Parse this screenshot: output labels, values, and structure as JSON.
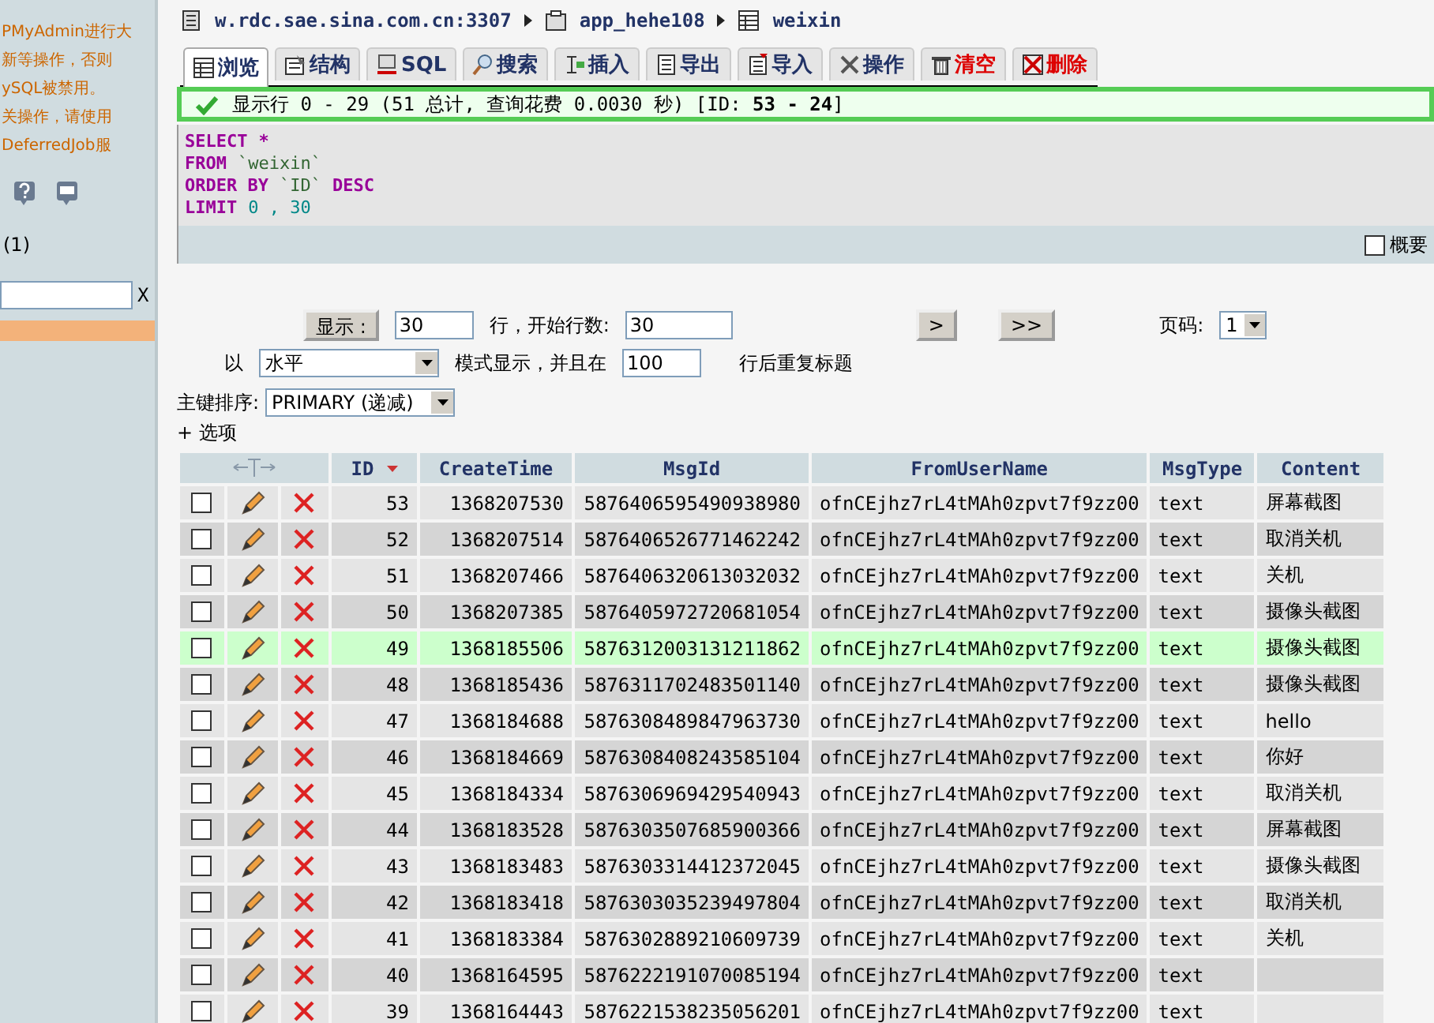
{
  "sidebar": {
    "notice_lines": [
      "PMyAdmin进行大",
      "新等操作，否则",
      "ySQL被禁用。",
      "关操作，请使用",
      "DeferredJob服"
    ],
    "count": "(1)",
    "filter_clear": "X"
  },
  "breadcrumb": {
    "server": "w.rdc.sae.sina.com.cn:3307",
    "database": "app_hehe108",
    "table": "weixin"
  },
  "tabs": [
    {
      "label": "浏览",
      "selected": true,
      "kind": "normal"
    },
    {
      "label": "结构",
      "selected": false,
      "kind": "normal"
    },
    {
      "label": "SQL",
      "selected": false,
      "kind": "normal"
    },
    {
      "label": "搜索",
      "selected": false,
      "kind": "normal"
    },
    {
      "label": "插入",
      "selected": false,
      "kind": "normal"
    },
    {
      "label": "导出",
      "selected": false,
      "kind": "normal"
    },
    {
      "label": "导入",
      "selected": false,
      "kind": "normal"
    },
    {
      "label": "操作",
      "selected": false,
      "kind": "normal"
    },
    {
      "label": "清空",
      "selected": false,
      "kind": "danger"
    },
    {
      "label": "删除",
      "selected": false,
      "kind": "danger"
    }
  ],
  "message": {
    "text": "显示行 0 - 29 (51 总计, 查询花费 0.0030 秒) [ID: **53 - 24**]"
  },
  "query": {
    "lines": [
      [
        {
          "kind": "keyword",
          "text": "SELECT"
        },
        {
          "kind": "keyword",
          "text": "*"
        }
      ],
      [
        {
          "kind": "keyword",
          "text": "FROM"
        },
        {
          "kind": "ident",
          "text": "`weixin`"
        }
      ],
      [
        {
          "kind": "keyword",
          "text": "ORDER BY"
        },
        {
          "kind": "ident",
          "text": "`ID`"
        },
        {
          "kind": "keyword",
          "text": "DESC"
        }
      ],
      [
        {
          "kind": "keyword",
          "text": "LIMIT"
        },
        {
          "kind": "number",
          "text": "0 , 30"
        }
      ]
    ],
    "profiling": {
      "label": "概要",
      "checked": false
    }
  },
  "navigation": {
    "show_button": "显示 :",
    "rows_value": "30",
    "rows_label": "行，开始行数:",
    "start_value": "30",
    "next_button": ">",
    "last_button": ">>",
    "page_label": "页码:",
    "page_value": "1",
    "mode_prefix": "以",
    "mode_value": "水平",
    "mode_label": "模式显示，并且在",
    "repeat_value": "100",
    "repeat_label": "行后重复标题",
    "sort_label": "主键排序:",
    "sort_value": "PRIMARY (递减)",
    "options_link": "+ 选项"
  },
  "table": {
    "columns": [
      "ID",
      "CreateTime",
      "MsgId",
      "FromUserName",
      "MsgType",
      "Content"
    ],
    "rows": [
      {
        "checked": false,
        "highlighted": false,
        "cells": [
          "53",
          "1368207530",
          "5876406595490938980",
          "ofnCEjhz7rL4tMAh0zpvt7f9zz00",
          "text",
          "屏幕截图"
        ]
      },
      {
        "checked": false,
        "highlighted": false,
        "cells": [
          "52",
          "1368207514",
          "5876406526771462242",
          "ofnCEjhz7rL4tMAh0zpvt7f9zz00",
          "text",
          "取消关机"
        ]
      },
      {
        "checked": false,
        "highlighted": false,
        "cells": [
          "51",
          "1368207466",
          "5876406320613032032",
          "ofnCEjhz7rL4tMAh0zpvt7f9zz00",
          "text",
          "关机"
        ]
      },
      {
        "checked": false,
        "highlighted": false,
        "cells": [
          "50",
          "1368207385",
          "5876405972720681054",
          "ofnCEjhz7rL4tMAh0zpvt7f9zz00",
          "text",
          "摄像头截图"
        ]
      },
      {
        "checked": false,
        "highlighted": true,
        "cells": [
          "49",
          "1368185506",
          "5876312003131211862",
          "ofnCEjhz7rL4tMAh0zpvt7f9zz00",
          "text",
          "摄像头截图"
        ]
      },
      {
        "checked": false,
        "highlighted": false,
        "cells": [
          "48",
          "1368185436",
          "5876311702483501140",
          "ofnCEjhz7rL4tMAh0zpvt7f9zz00",
          "text",
          "摄像头截图"
        ]
      },
      {
        "checked": false,
        "highlighted": false,
        "cells": [
          "47",
          "1368184688",
          "5876308489847963730",
          "ofnCEjhz7rL4tMAh0zpvt7f9zz00",
          "text",
          "hello"
        ]
      },
      {
        "checked": false,
        "highlighted": false,
        "cells": [
          "46",
          "1368184669",
          "5876308408243585104",
          "ofnCEjhz7rL4tMAh0zpvt7f9zz00",
          "text",
          "你好"
        ]
      },
      {
        "checked": false,
        "highlighted": false,
        "cells": [
          "45",
          "1368184334",
          "5876306969429540943",
          "ofnCEjhz7rL4tMAh0zpvt7f9zz00",
          "text",
          "取消关机"
        ]
      },
      {
        "checked": false,
        "highlighted": false,
        "cells": [
          "44",
          "1368183528",
          "5876303507685900366",
          "ofnCEjhz7rL4tMAh0zpvt7f9zz00",
          "text",
          "屏幕截图"
        ]
      },
      {
        "checked": false,
        "highlighted": false,
        "cells": [
          "43",
          "1368183483",
          "5876303314412372045",
          "ofnCEjhz7rL4tMAh0zpvt7f9zz00",
          "text",
          "摄像头截图"
        ]
      },
      {
        "checked": false,
        "highlighted": false,
        "cells": [
          "42",
          "1368183418",
          "5876303035239497804",
          "ofnCEjhz7rL4tMAh0zpvt7f9zz00",
          "text",
          "取消关机"
        ]
      },
      {
        "checked": false,
        "highlighted": false,
        "cells": [
          "41",
          "1368183384",
          "5876302889210609739",
          "ofnCEjhz7rL4tMAh0zpvt7f9zz00",
          "text",
          "关机"
        ]
      },
      {
        "checked": false,
        "highlighted": false,
        "cells": [
          "40",
          "1368164595",
          "5876222191070085194",
          "ofnCEjhz7rL4tMAh0zpvt7f9zz00",
          "text"
        ]
      },
      {
        "checked": false,
        "highlighted": false,
        "cells": [
          "39",
          "1368164443",
          "5876221538235056201",
          "ofnCEjhz7rL4tMAh0zpvt7f9zz00",
          "text"
        ]
      }
    ]
  }
}
